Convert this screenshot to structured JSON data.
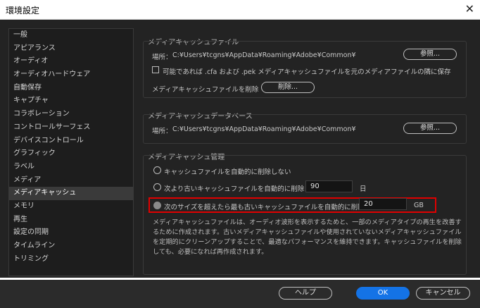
{
  "window": {
    "title": "環境設定",
    "close_glyph": "✕"
  },
  "sidebar": {
    "items": [
      "一般",
      "アピアランス",
      "オーディオ",
      "オーディオハードウェア",
      "自動保存",
      "キャプチャ",
      "コラボレーション",
      "コントロールサーフェス",
      "デバイスコントロール",
      "グラフィック",
      "ラベル",
      "メディア",
      "メディアキャッシュ",
      "メモリ",
      "再生",
      "設定の同期",
      "タイムライン",
      "トリミング"
    ],
    "selected": "メディアキャッシュ"
  },
  "media_cache_files": {
    "section_title": "メディアキャッシュファイル",
    "location_label": "場所：",
    "location_path": "C:¥Users¥tcgns¥AppData¥Roaming¥Adobe¥Common¥",
    "browse_label": "参照...",
    "save_next_checkbox_label": "可能であれば .cfa および .pek メディアキャッシュファイルを元のメディアファイルの隣に保存",
    "save_next_checked": false,
    "delete_files_label": "メディアキャッシュファイルを削除",
    "delete_button_label": "削除..."
  },
  "media_cache_db": {
    "section_title": "メディアキャッシュデータベース",
    "location_label": "場所：",
    "location_path": "C:¥Users¥tcgns¥AppData¥Roaming¥Adobe¥Common¥",
    "browse_label": "参照..."
  },
  "cache_management": {
    "section_title": "メディアキャッシュ管理",
    "option_no_auto_delete": "キャッシュファイルを自動的に削除しない",
    "option_delete_older": "次より古いキャッシュファイルを自動的に削除：",
    "older_than_value": "90",
    "older_than_unit": "日",
    "option_delete_over_size": "次のサイズを超えたら最も古いキャッシュファイルを自動的に削除：",
    "over_size_value": "20",
    "over_size_unit": "GB",
    "selected_option": "over_size",
    "description": "メディアキャッシュファイルは、オーディオ波形を表示するためと、一部のメディアタイプの再生を改善するために作成されます。古いメディアキャッシュファイルや使用されていないメディアキャッシュファイルを定期的にクリーンアップすることで、最適なパフォーマンスを維持できます。キャッシュファイルを削除しても、必要になれば再作成されます。",
    "highlight_color": "#e00000"
  },
  "footer": {
    "help_label": "ヘルプ",
    "ok_label": "OK",
    "cancel_label": "キャンセル",
    "ok_color": "#1473e6"
  }
}
